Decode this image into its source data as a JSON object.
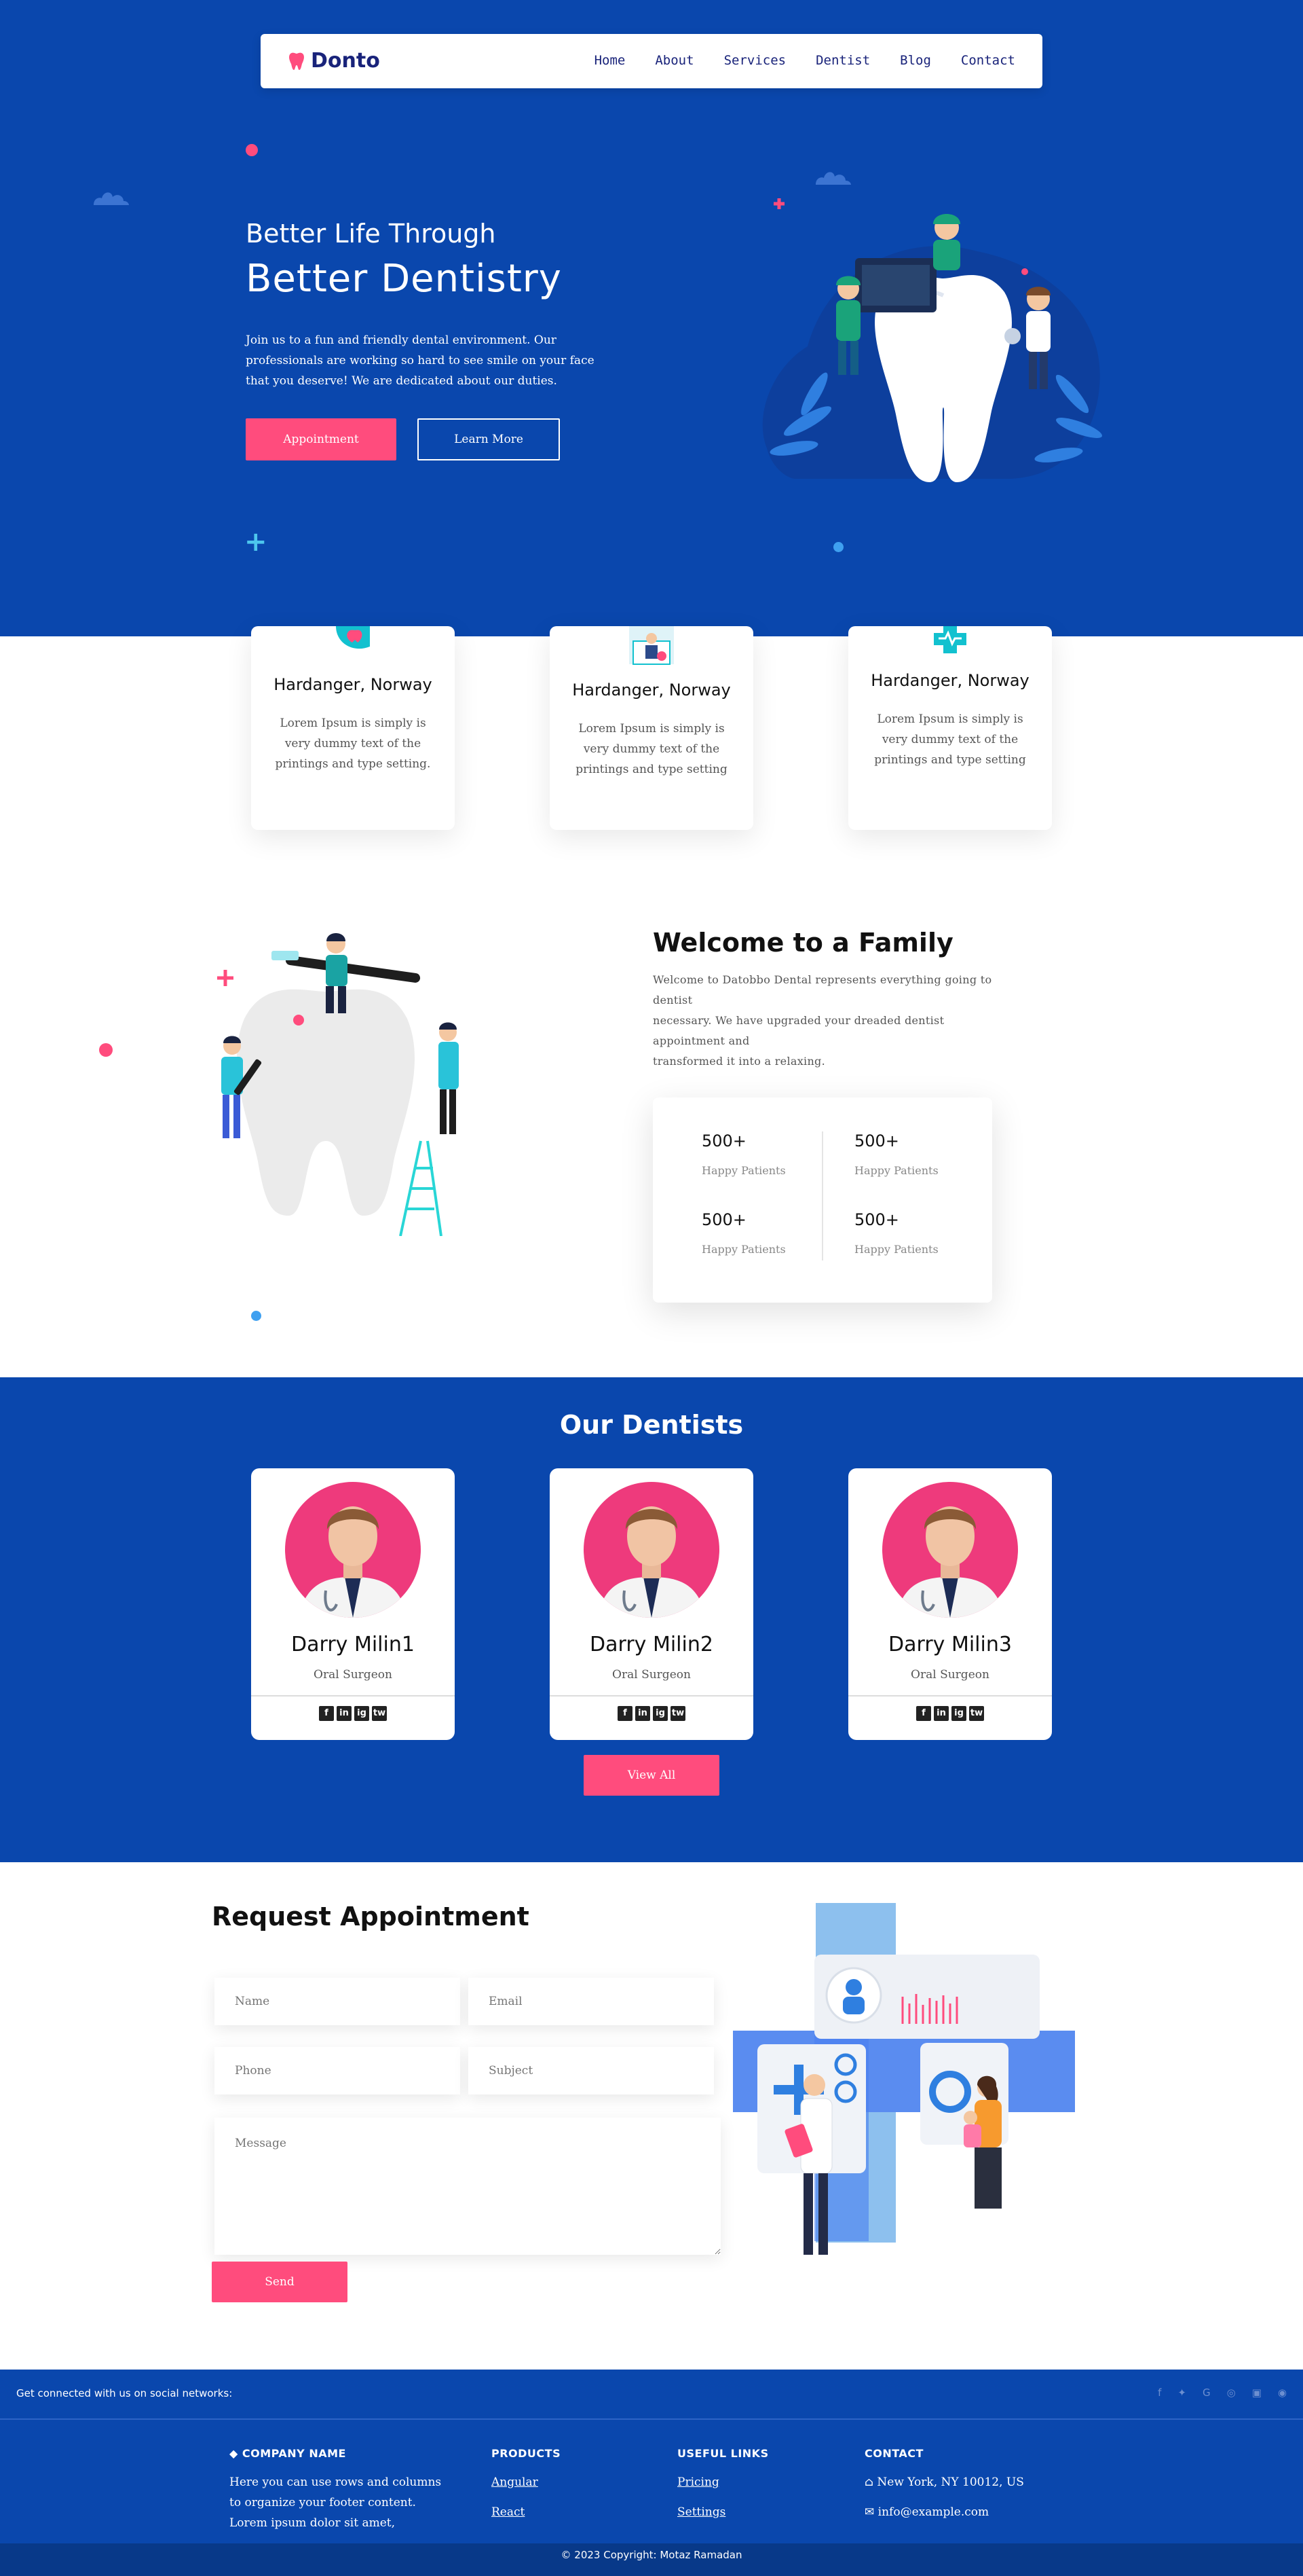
{
  "nav": {
    "logo": "Donto",
    "links": [
      "Home",
      "About",
      "Services",
      "Dentist",
      "Blog",
      "Contact"
    ]
  },
  "hero": {
    "subtitle": "Better Life Through",
    "title": "Better Dentistry",
    "description": "Join us to a fun and friendly dental environment. Our professionals are working so hard to see smile on your face that you deserve! We are dedicated about our duties.",
    "primary_button": "Appointment",
    "secondary_button": "Learn More"
  },
  "features": [
    {
      "title": "Hardanger, Norway",
      "text": "Lorem Ipsum is simply is very dummy text of the printings and type setting.",
      "icon": "phone-tooth-icon"
    },
    {
      "title": "Hardanger, Norway",
      "text": "Lorem Ipsum is simply is very dummy text of the printings and type setting",
      "icon": "doctor-monitor-icon"
    },
    {
      "title": "Hardanger, Norway",
      "text": "Lorem Ipsum is simply is very dummy text of the printings and type setting",
      "icon": "medical-cross-icon"
    }
  ],
  "welcome": {
    "title": "Welcome to a Family",
    "lines": [
      "Welcome to Datobbo Dental represents everything going to dentist",
      "necessary. We have upgraded your dreaded dentist appointment and",
      "transformed it into a relaxing."
    ],
    "stats": [
      {
        "value": "500+",
        "label": "Happy Patients"
      },
      {
        "value": "500+",
        "label": "Happy Patients"
      },
      {
        "value": "500+",
        "label": "Happy Patients"
      },
      {
        "value": "500+",
        "label": "Happy Patients"
      }
    ]
  },
  "dentists": {
    "title": "Our Dentists",
    "items": [
      {
        "name": "Darry Milin1",
        "role": "Oral Surgeon"
      },
      {
        "name": "Darry Milin2",
        "role": "Oral Surgeon"
      },
      {
        "name": "Darry Milin3",
        "role": "Oral Surgeon"
      }
    ],
    "social_icons": [
      "f",
      "in",
      "ig",
      "tw"
    ],
    "view_all": "View All"
  },
  "appointment": {
    "title": "Request Appointment",
    "placeholders": {
      "name": "Name",
      "email": "Email",
      "phone": "Phone",
      "subject": "Subject",
      "message": "Message"
    },
    "send": "Send"
  },
  "footer": {
    "connect": "Get connected with us on social networks:",
    "company_heading": "COMPANY NAME",
    "company_text": "Here you can use rows and columns to organize your footer content. Lorem ipsum dolor sit amet,",
    "products_heading": "PRODUCTS",
    "products": [
      "Angular",
      "React"
    ],
    "links_heading": "USEFUL LINKS",
    "links": [
      "Pricing",
      "Settings"
    ],
    "contact_heading": "CONTACT",
    "address": "New York, NY 10012, US",
    "email": "info@example.com",
    "copyright": "© 2023 Copyright: Motaz Ramadan"
  },
  "colors": {
    "primary_blue": "#0a47ad",
    "accent_pink": "#ff4c7d",
    "navy_text": "#19237a"
  }
}
